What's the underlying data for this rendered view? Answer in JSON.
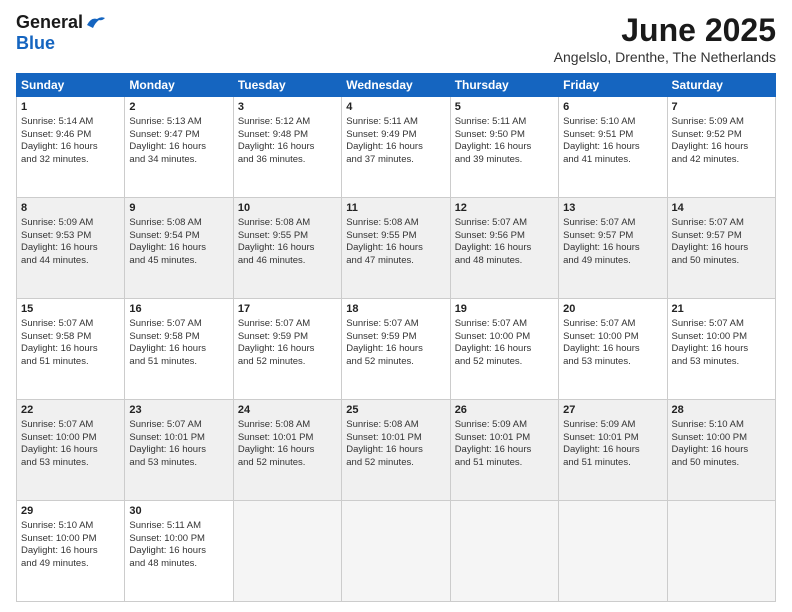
{
  "header": {
    "logo_general": "General",
    "logo_blue": "Blue",
    "title": "June 2025",
    "location": "Angelslo, Drenthe, The Netherlands"
  },
  "days_of_week": [
    "Sunday",
    "Monday",
    "Tuesday",
    "Wednesday",
    "Thursday",
    "Friday",
    "Saturday"
  ],
  "weeks": [
    {
      "shaded": false,
      "days": [
        {
          "num": "1",
          "lines": [
            "Sunrise: 5:14 AM",
            "Sunset: 9:46 PM",
            "Daylight: 16 hours",
            "and 32 minutes."
          ]
        },
        {
          "num": "2",
          "lines": [
            "Sunrise: 5:13 AM",
            "Sunset: 9:47 PM",
            "Daylight: 16 hours",
            "and 34 minutes."
          ]
        },
        {
          "num": "3",
          "lines": [
            "Sunrise: 5:12 AM",
            "Sunset: 9:48 PM",
            "Daylight: 16 hours",
            "and 36 minutes."
          ]
        },
        {
          "num": "4",
          "lines": [
            "Sunrise: 5:11 AM",
            "Sunset: 9:49 PM",
            "Daylight: 16 hours",
            "and 37 minutes."
          ]
        },
        {
          "num": "5",
          "lines": [
            "Sunrise: 5:11 AM",
            "Sunset: 9:50 PM",
            "Daylight: 16 hours",
            "and 39 minutes."
          ]
        },
        {
          "num": "6",
          "lines": [
            "Sunrise: 5:10 AM",
            "Sunset: 9:51 PM",
            "Daylight: 16 hours",
            "and 41 minutes."
          ]
        },
        {
          "num": "7",
          "lines": [
            "Sunrise: 5:09 AM",
            "Sunset: 9:52 PM",
            "Daylight: 16 hours",
            "and 42 minutes."
          ]
        }
      ]
    },
    {
      "shaded": true,
      "days": [
        {
          "num": "8",
          "lines": [
            "Sunrise: 5:09 AM",
            "Sunset: 9:53 PM",
            "Daylight: 16 hours",
            "and 44 minutes."
          ]
        },
        {
          "num": "9",
          "lines": [
            "Sunrise: 5:08 AM",
            "Sunset: 9:54 PM",
            "Daylight: 16 hours",
            "and 45 minutes."
          ]
        },
        {
          "num": "10",
          "lines": [
            "Sunrise: 5:08 AM",
            "Sunset: 9:55 PM",
            "Daylight: 16 hours",
            "and 46 minutes."
          ]
        },
        {
          "num": "11",
          "lines": [
            "Sunrise: 5:08 AM",
            "Sunset: 9:55 PM",
            "Daylight: 16 hours",
            "and 47 minutes."
          ]
        },
        {
          "num": "12",
          "lines": [
            "Sunrise: 5:07 AM",
            "Sunset: 9:56 PM",
            "Daylight: 16 hours",
            "and 48 minutes."
          ]
        },
        {
          "num": "13",
          "lines": [
            "Sunrise: 5:07 AM",
            "Sunset: 9:57 PM",
            "Daylight: 16 hours",
            "and 49 minutes."
          ]
        },
        {
          "num": "14",
          "lines": [
            "Sunrise: 5:07 AM",
            "Sunset: 9:57 PM",
            "Daylight: 16 hours",
            "and 50 minutes."
          ]
        }
      ]
    },
    {
      "shaded": false,
      "days": [
        {
          "num": "15",
          "lines": [
            "Sunrise: 5:07 AM",
            "Sunset: 9:58 PM",
            "Daylight: 16 hours",
            "and 51 minutes."
          ]
        },
        {
          "num": "16",
          "lines": [
            "Sunrise: 5:07 AM",
            "Sunset: 9:58 PM",
            "Daylight: 16 hours",
            "and 51 minutes."
          ]
        },
        {
          "num": "17",
          "lines": [
            "Sunrise: 5:07 AM",
            "Sunset: 9:59 PM",
            "Daylight: 16 hours",
            "and 52 minutes."
          ]
        },
        {
          "num": "18",
          "lines": [
            "Sunrise: 5:07 AM",
            "Sunset: 9:59 PM",
            "Daylight: 16 hours",
            "and 52 minutes."
          ]
        },
        {
          "num": "19",
          "lines": [
            "Sunrise: 5:07 AM",
            "Sunset: 10:00 PM",
            "Daylight: 16 hours",
            "and 52 minutes."
          ]
        },
        {
          "num": "20",
          "lines": [
            "Sunrise: 5:07 AM",
            "Sunset: 10:00 PM",
            "Daylight: 16 hours",
            "and 53 minutes."
          ]
        },
        {
          "num": "21",
          "lines": [
            "Sunrise: 5:07 AM",
            "Sunset: 10:00 PM",
            "Daylight: 16 hours",
            "and 53 minutes."
          ]
        }
      ]
    },
    {
      "shaded": true,
      "days": [
        {
          "num": "22",
          "lines": [
            "Sunrise: 5:07 AM",
            "Sunset: 10:00 PM",
            "Daylight: 16 hours",
            "and 53 minutes."
          ]
        },
        {
          "num": "23",
          "lines": [
            "Sunrise: 5:07 AM",
            "Sunset: 10:01 PM",
            "Daylight: 16 hours",
            "and 53 minutes."
          ]
        },
        {
          "num": "24",
          "lines": [
            "Sunrise: 5:08 AM",
            "Sunset: 10:01 PM",
            "Daylight: 16 hours",
            "and 52 minutes."
          ]
        },
        {
          "num": "25",
          "lines": [
            "Sunrise: 5:08 AM",
            "Sunset: 10:01 PM",
            "Daylight: 16 hours",
            "and 52 minutes."
          ]
        },
        {
          "num": "26",
          "lines": [
            "Sunrise: 5:09 AM",
            "Sunset: 10:01 PM",
            "Daylight: 16 hours",
            "and 51 minutes."
          ]
        },
        {
          "num": "27",
          "lines": [
            "Sunrise: 5:09 AM",
            "Sunset: 10:01 PM",
            "Daylight: 16 hours",
            "and 51 minutes."
          ]
        },
        {
          "num": "28",
          "lines": [
            "Sunrise: 5:10 AM",
            "Sunset: 10:00 PM",
            "Daylight: 16 hours",
            "and 50 minutes."
          ]
        }
      ]
    },
    {
      "shaded": false,
      "days": [
        {
          "num": "29",
          "lines": [
            "Sunrise: 5:10 AM",
            "Sunset: 10:00 PM",
            "Daylight: 16 hours",
            "and 49 minutes."
          ]
        },
        {
          "num": "30",
          "lines": [
            "Sunrise: 5:11 AM",
            "Sunset: 10:00 PM",
            "Daylight: 16 hours",
            "and 48 minutes."
          ]
        },
        null,
        null,
        null,
        null,
        null
      ]
    }
  ]
}
